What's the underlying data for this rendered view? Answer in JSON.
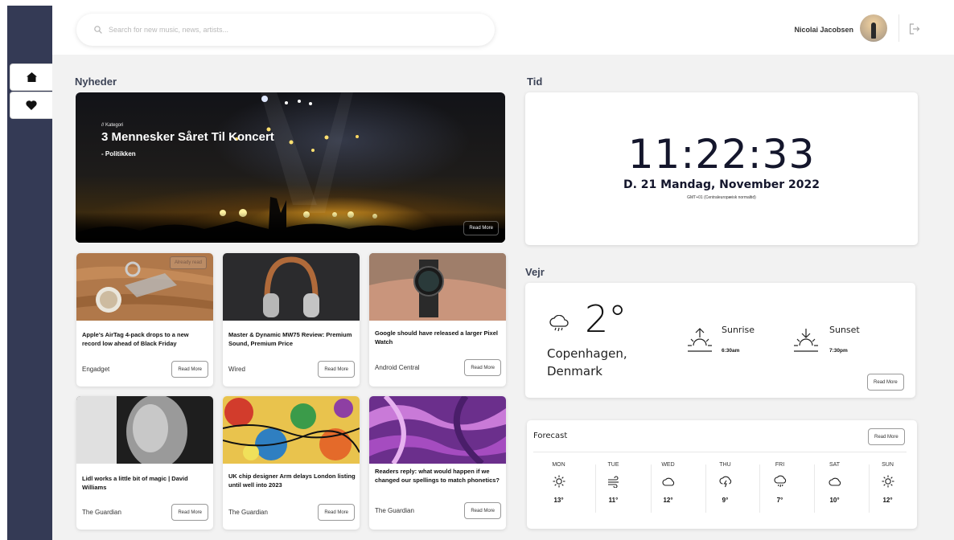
{
  "search": {
    "placeholder": "Search for new music, news, artists..."
  },
  "user": {
    "name": "Nicolai Jacobsen"
  },
  "nav": [
    {
      "icon": "home-icon"
    },
    {
      "icon": "heart-icon"
    }
  ],
  "news": {
    "title": "Nyheder",
    "hero": {
      "category": "// Kategori",
      "headline": "3 Mennesker Såret Til Koncert",
      "source": "- Politikken",
      "button": "Read More"
    },
    "cards": [
      {
        "title": "Apple's AirTag 4-pack drops to a new record low ahead of Black Friday",
        "source": "Engadget",
        "button": "Read More",
        "tag": "Already read"
      },
      {
        "title": "Master & Dynamic MW75 Review: Premium Sound, Premium Price",
        "source": "Wired",
        "button": "Read More"
      },
      {
        "title": "Google should have released a larger Pixel Watch",
        "source": "Android Central",
        "button": "Read More"
      },
      {
        "title": "Lidl works a little bit of magic | David Williams",
        "source": "The Guardian",
        "button": "Read More"
      },
      {
        "title": "UK chip designer Arm delays London listing until well into 2023",
        "source": "The Guardian",
        "button": "Read More"
      },
      {
        "title": "Readers reply: what would happen if we changed our spellings to match phonetics?",
        "source": "The Guardian",
        "button": "Read More"
      }
    ]
  },
  "time": {
    "title": "Tid",
    "clock": "11:22:33",
    "date": "D. 21 Mandag, November  2022",
    "timezone": "GMT+01 (Centraleuropæisk normaltid)"
  },
  "weather": {
    "title": "Vejr",
    "temperature": "2°",
    "city": "Copenhagen, Denmark",
    "sunrise_label": "Sunrise",
    "sunrise_time": "6:30am",
    "sunset_label": "Sunset",
    "sunset_time": "7:30pm",
    "button": "Read More",
    "icon": "rain-cloud-icon"
  },
  "forecast": {
    "title": "Forecast",
    "button": "Read More",
    "days": [
      {
        "day": "MON",
        "icon": "sun-icon",
        "temp": "13°"
      },
      {
        "day": "TUE",
        "icon": "wind-icon",
        "temp": "11°"
      },
      {
        "day": "WED",
        "icon": "cloud-icon",
        "temp": "12°"
      },
      {
        "day": "THU",
        "icon": "thunder-icon",
        "temp": "9°"
      },
      {
        "day": "FRI",
        "icon": "rain-cloud-icon",
        "temp": "7°"
      },
      {
        "day": "SAT",
        "icon": "cloud-icon",
        "temp": "10°"
      },
      {
        "day": "SUN",
        "icon": "sun-icon",
        "temp": "12°"
      }
    ]
  },
  "colors": {
    "sidebar": "#343a55",
    "background": "#f2f2f2",
    "heading": "#3d4457",
    "clock": "#14162c"
  }
}
